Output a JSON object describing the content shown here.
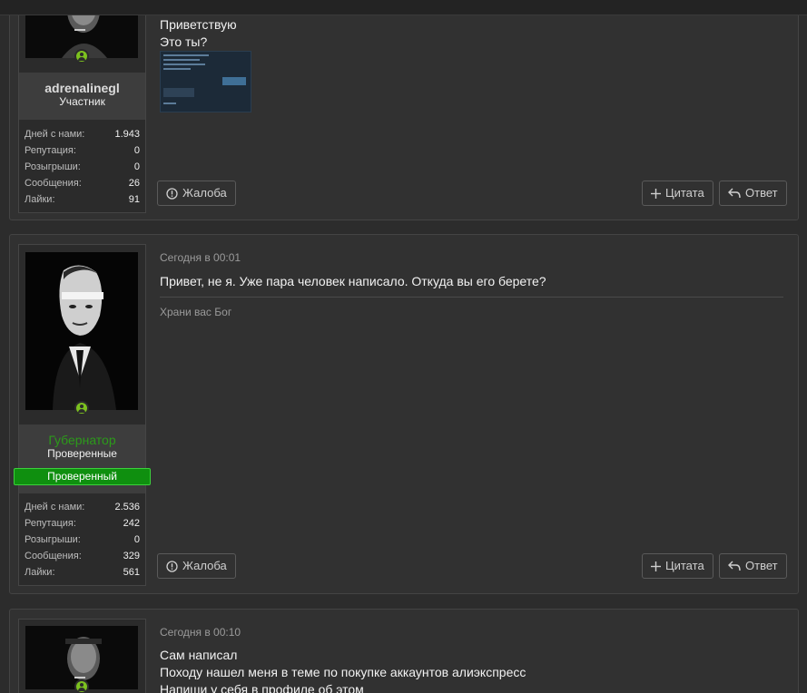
{
  "posts": [
    {
      "user": {
        "name": "adrenalinegl",
        "title": "Участник",
        "stats": [
          {
            "label": "Дней с нами:",
            "value": "1.943"
          },
          {
            "label": "Репутация:",
            "value": "0"
          },
          {
            "label": "Розыгрыши:",
            "value": "0"
          },
          {
            "label": "Сообщения:",
            "value": "26"
          },
          {
            "label": "Лайки:",
            "value": "91"
          }
        ]
      },
      "lines": [
        "Приветствую",
        "Это ты?"
      ],
      "actions": {
        "report": "Жалоба",
        "quote": "Цитата",
        "reply": "Ответ"
      }
    },
    {
      "user": {
        "name": "Губернатор",
        "title": "Проверенные",
        "banner": "Проверенный",
        "stats": [
          {
            "label": "Дней с нами:",
            "value": "2.536"
          },
          {
            "label": "Репутация:",
            "value": "242"
          },
          {
            "label": "Розыгрыши:",
            "value": "0"
          },
          {
            "label": "Сообщения:",
            "value": "329"
          },
          {
            "label": "Лайки:",
            "value": "561"
          }
        ]
      },
      "date": "Сегодня в 00:01",
      "lines": [
        "Привет, не я. Уже пара человек написало. Откуда вы его берете?"
      ],
      "signature": "Храни вас Бог",
      "actions": {
        "report": "Жалоба",
        "quote": "Цитата",
        "reply": "Ответ"
      }
    },
    {
      "date": "Сегодня в 00:10",
      "lines": [
        "Сам написал",
        "Походу нашел меня в теме по покупке аккаунтов алиэкспресс",
        "Напиши у себя в профиле об этом"
      ]
    }
  ],
  "colors": {
    "accent_green": "#2c9a1a",
    "online": "#7cc11f",
    "banner": "#0f8f0f"
  },
  "icons": [
    "report-icon",
    "plus-icon",
    "reply-icon",
    "online-user-icon"
  ]
}
